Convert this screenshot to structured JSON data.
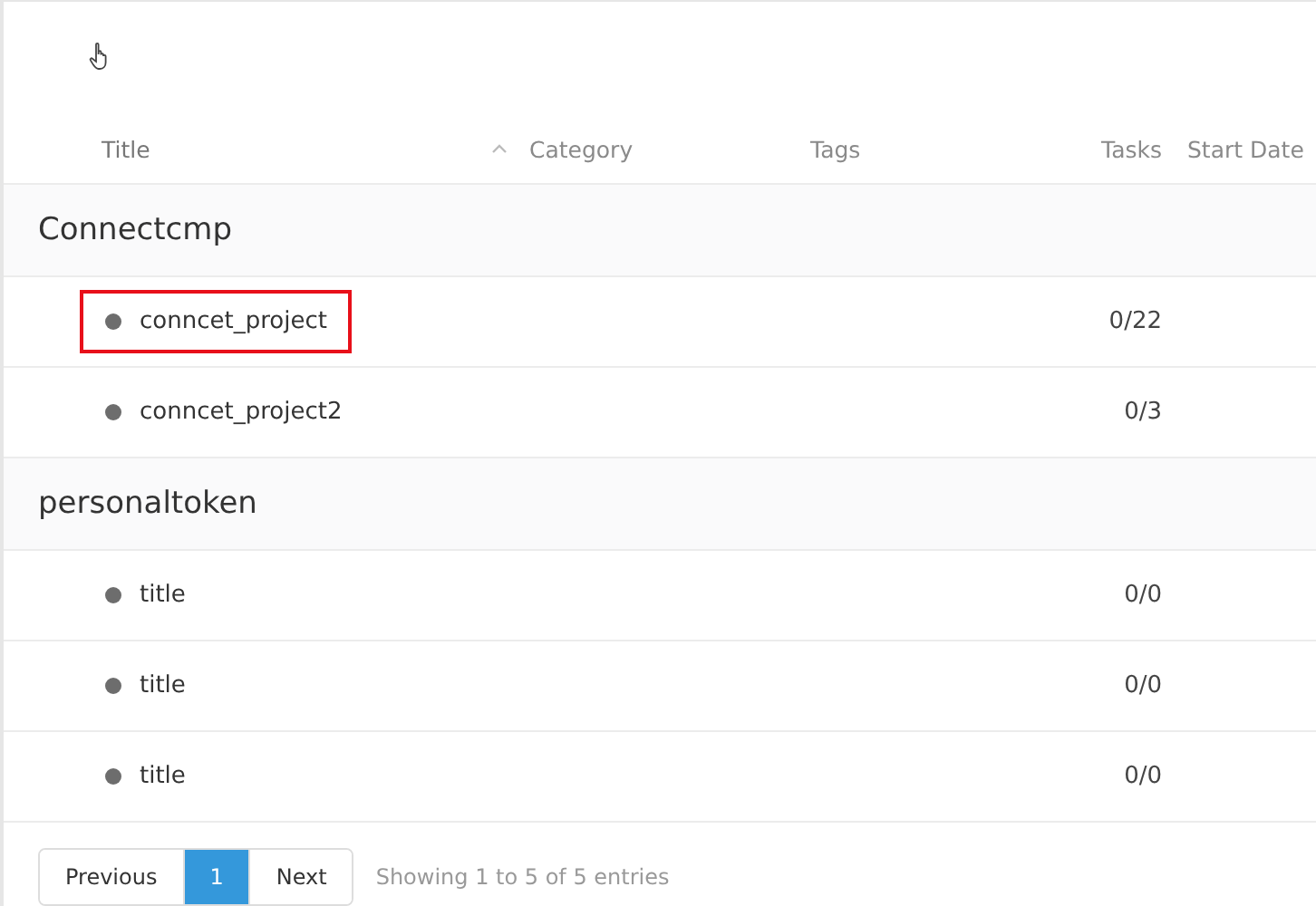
{
  "table": {
    "columns": [
      {
        "label": "Title",
        "sorted": true
      },
      {
        "label": "Category",
        "sorted": false
      },
      {
        "label": "Tags",
        "sorted": false
      },
      {
        "label": "Tasks",
        "sorted": false
      },
      {
        "label": "Start Date",
        "sorted": false
      }
    ],
    "groups": [
      {
        "name": "Connectcmp",
        "rows": [
          {
            "title": "conncet_project",
            "tasks": "0/22",
            "highlighted": true
          },
          {
            "title": "conncet_project2",
            "tasks": "0/3",
            "highlighted": false
          }
        ]
      },
      {
        "name": "personaltoken",
        "rows": [
          {
            "title": "title",
            "tasks": "0/0",
            "highlighted": false
          },
          {
            "title": "title",
            "tasks": "0/0",
            "highlighted": false
          },
          {
            "title": "title",
            "tasks": "0/0",
            "highlighted": false
          }
        ]
      }
    ]
  },
  "pagination": {
    "previous": "Previous",
    "pages": [
      {
        "label": "1",
        "selected": true
      }
    ],
    "next": "Next",
    "info": "Showing 1 to 5 of 5 entries"
  }
}
